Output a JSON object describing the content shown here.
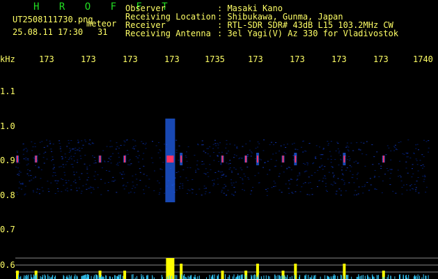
{
  "header": {
    "station": "H R O F F T",
    "filename": "UT2508111730.png",
    "tag": "meteor",
    "datetime": "25.08.11 17:30",
    "count": "31",
    "fields": [
      {
        "label": "Observer",
        "value": ": Masaki Kano"
      },
      {
        "label": "Receiving Location",
        "value": ": Shibukawa, Gunma, Japan"
      },
      {
        "label": "Receiver",
        "value": ": RTL-SDR SDR# 43dB L15 103.2MHz CW"
      },
      {
        "label": "Receiving Antenna",
        "value": ": 3el Yagi(V) Az 330 for Vladivostok"
      }
    ]
  },
  "x_axis": {
    "unit": "kHz",
    "ticks": [
      "173",
      "173",
      "173",
      "173",
      "1735",
      "173",
      "173",
      "173",
      "173",
      "1740"
    ]
  },
  "y_axis": {
    "ticks": [
      "1.1",
      "1.0",
      "0.9",
      "0.8",
      "0.7",
      "0.6"
    ]
  },
  "colors": {
    "text": "#ffff66",
    "station": "#22dd22",
    "signal_core": "#ff3366",
    "signal_mid": "#2266ff",
    "noise": "#001a66",
    "meter_yellow": "#ffff00",
    "meter_cyan": "#33ccff"
  },
  "events": [
    {
      "time_min": 0.3,
      "strength": "weak"
    },
    {
      "time_min": 3.0,
      "strength": "weak"
    },
    {
      "time_min": 12.3,
      "strength": "weak"
    },
    {
      "time_min": 15.9,
      "strength": "weak"
    },
    {
      "time_min": 22.5,
      "strength": "strong"
    },
    {
      "time_min": 24.1,
      "strength": "medium"
    },
    {
      "time_min": 30.1,
      "strength": "weak"
    },
    {
      "time_min": 33.5,
      "strength": "weak"
    },
    {
      "time_min": 35.2,
      "strength": "medium"
    },
    {
      "time_min": 38.9,
      "strength": "weak"
    },
    {
      "time_min": 40.7,
      "strength": "medium"
    },
    {
      "time_min": 47.8,
      "strength": "medium"
    },
    {
      "time_min": 53.5,
      "strength": "weak"
    }
  ]
}
